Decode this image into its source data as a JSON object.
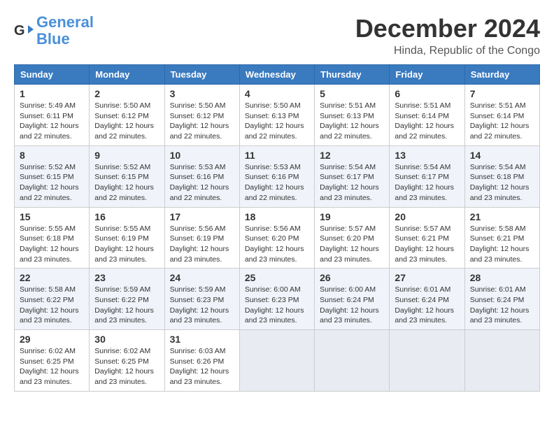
{
  "logo": {
    "line1": "General",
    "line2": "Blue"
  },
  "title": "December 2024",
  "location": "Hinda, Republic of the Congo",
  "weekdays": [
    "Sunday",
    "Monday",
    "Tuesday",
    "Wednesday",
    "Thursday",
    "Friday",
    "Saturday"
  ],
  "weeks": [
    [
      {
        "day": "1",
        "sunrise": "5:49 AM",
        "sunset": "6:11 PM",
        "daylight": "12 hours and 22 minutes."
      },
      {
        "day": "2",
        "sunrise": "5:50 AM",
        "sunset": "6:12 PM",
        "daylight": "12 hours and 22 minutes."
      },
      {
        "day": "3",
        "sunrise": "5:50 AM",
        "sunset": "6:12 PM",
        "daylight": "12 hours and 22 minutes."
      },
      {
        "day": "4",
        "sunrise": "5:50 AM",
        "sunset": "6:13 PM",
        "daylight": "12 hours and 22 minutes."
      },
      {
        "day": "5",
        "sunrise": "5:51 AM",
        "sunset": "6:13 PM",
        "daylight": "12 hours and 22 minutes."
      },
      {
        "day": "6",
        "sunrise": "5:51 AM",
        "sunset": "6:14 PM",
        "daylight": "12 hours and 22 minutes."
      },
      {
        "day": "7",
        "sunrise": "5:51 AM",
        "sunset": "6:14 PM",
        "daylight": "12 hours and 22 minutes."
      }
    ],
    [
      {
        "day": "8",
        "sunrise": "5:52 AM",
        "sunset": "6:15 PM",
        "daylight": "12 hours and 22 minutes."
      },
      {
        "day": "9",
        "sunrise": "5:52 AM",
        "sunset": "6:15 PM",
        "daylight": "12 hours and 22 minutes."
      },
      {
        "day": "10",
        "sunrise": "5:53 AM",
        "sunset": "6:16 PM",
        "daylight": "12 hours and 22 minutes."
      },
      {
        "day": "11",
        "sunrise": "5:53 AM",
        "sunset": "6:16 PM",
        "daylight": "12 hours and 22 minutes."
      },
      {
        "day": "12",
        "sunrise": "5:54 AM",
        "sunset": "6:17 PM",
        "daylight": "12 hours and 23 minutes."
      },
      {
        "day": "13",
        "sunrise": "5:54 AM",
        "sunset": "6:17 PM",
        "daylight": "12 hours and 23 minutes."
      },
      {
        "day": "14",
        "sunrise": "5:54 AM",
        "sunset": "6:18 PM",
        "daylight": "12 hours and 23 minutes."
      }
    ],
    [
      {
        "day": "15",
        "sunrise": "5:55 AM",
        "sunset": "6:18 PM",
        "daylight": "12 hours and 23 minutes."
      },
      {
        "day": "16",
        "sunrise": "5:55 AM",
        "sunset": "6:19 PM",
        "daylight": "12 hours and 23 minutes."
      },
      {
        "day": "17",
        "sunrise": "5:56 AM",
        "sunset": "6:19 PM",
        "daylight": "12 hours and 23 minutes."
      },
      {
        "day": "18",
        "sunrise": "5:56 AM",
        "sunset": "6:20 PM",
        "daylight": "12 hours and 23 minutes."
      },
      {
        "day": "19",
        "sunrise": "5:57 AM",
        "sunset": "6:20 PM",
        "daylight": "12 hours and 23 minutes."
      },
      {
        "day": "20",
        "sunrise": "5:57 AM",
        "sunset": "6:21 PM",
        "daylight": "12 hours and 23 minutes."
      },
      {
        "day": "21",
        "sunrise": "5:58 AM",
        "sunset": "6:21 PM",
        "daylight": "12 hours and 23 minutes."
      }
    ],
    [
      {
        "day": "22",
        "sunrise": "5:58 AM",
        "sunset": "6:22 PM",
        "daylight": "12 hours and 23 minutes."
      },
      {
        "day": "23",
        "sunrise": "5:59 AM",
        "sunset": "6:22 PM",
        "daylight": "12 hours and 23 minutes."
      },
      {
        "day": "24",
        "sunrise": "5:59 AM",
        "sunset": "6:23 PM",
        "daylight": "12 hours and 23 minutes."
      },
      {
        "day": "25",
        "sunrise": "6:00 AM",
        "sunset": "6:23 PM",
        "daylight": "12 hours and 23 minutes."
      },
      {
        "day": "26",
        "sunrise": "6:00 AM",
        "sunset": "6:24 PM",
        "daylight": "12 hours and 23 minutes."
      },
      {
        "day": "27",
        "sunrise": "6:01 AM",
        "sunset": "6:24 PM",
        "daylight": "12 hours and 23 minutes."
      },
      {
        "day": "28",
        "sunrise": "6:01 AM",
        "sunset": "6:24 PM",
        "daylight": "12 hours and 23 minutes."
      }
    ],
    [
      {
        "day": "29",
        "sunrise": "6:02 AM",
        "sunset": "6:25 PM",
        "daylight": "12 hours and 23 minutes."
      },
      {
        "day": "30",
        "sunrise": "6:02 AM",
        "sunset": "6:25 PM",
        "daylight": "12 hours and 23 minutes."
      },
      {
        "day": "31",
        "sunrise": "6:03 AM",
        "sunset": "6:26 PM",
        "daylight": "12 hours and 23 minutes."
      },
      null,
      null,
      null,
      null
    ]
  ]
}
